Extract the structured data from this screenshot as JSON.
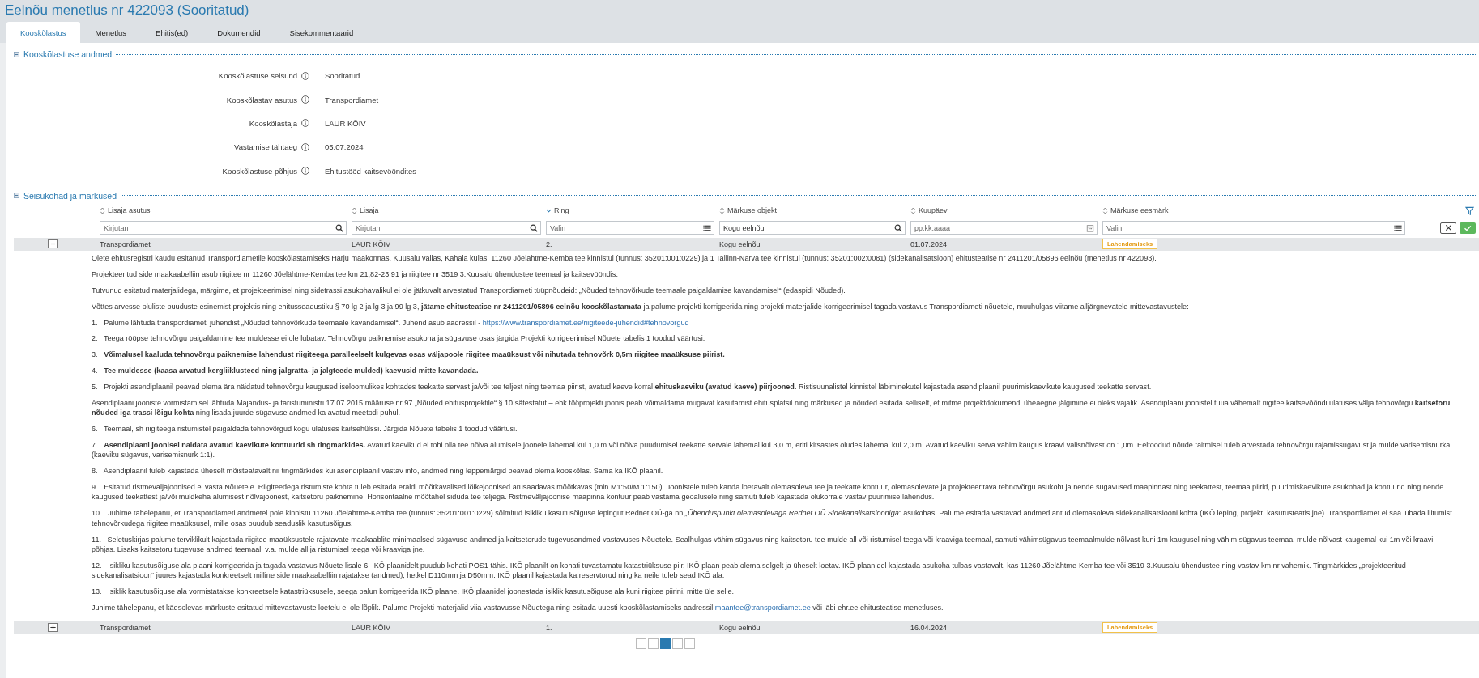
{
  "title": "Eelnõu menetlus nr 422093 (Sooritatud)",
  "tabs": [
    {
      "label": "Kooskõlastus",
      "selected": true
    },
    {
      "label": "Menetlus",
      "selected": false
    },
    {
      "label": "Ehitis(ed)",
      "selected": false
    },
    {
      "label": "Dokumendid",
      "selected": false
    },
    {
      "label": "Sisekommentaarid",
      "selected": false
    }
  ],
  "details": {
    "title": "Kooskõlastuse andmed",
    "expanded": true,
    "fields": [
      {
        "label": "Kooskõlastuse seisund",
        "value": "Sooritatud"
      },
      {
        "label": "Kooskõlastav asutus",
        "value": "Transpordiamet"
      },
      {
        "label": "Kooskõlastaja",
        "value": "LAUR KÕIV"
      },
      {
        "label": "Vastamise tähtaeg",
        "value": "05.07.2024"
      },
      {
        "label": "Kooskõlastuse põhjus",
        "value": "Ehitustööd kaitsevööndites"
      }
    ]
  },
  "remarks": {
    "title": "Seisukohad ja märkused",
    "expanded": true,
    "columns": [
      {
        "label": "Lisaja asutus",
        "sorted": false
      },
      {
        "label": "Lisaja",
        "sorted": false
      },
      {
        "label": "Ring",
        "sorted": true
      },
      {
        "label": "Märkuse objekt",
        "sorted": false
      },
      {
        "label": "Kuupäev",
        "sorted": false
      },
      {
        "label": "Märkuse eesmärk",
        "sorted": false
      }
    ],
    "filters": [
      {
        "kind": "search",
        "placeholder": "Kirjutan"
      },
      {
        "kind": "search",
        "placeholder": "Kirjutan"
      },
      {
        "kind": "list",
        "placeholder": "Valin"
      },
      {
        "kind": "search",
        "value": "Kogu eelnõu"
      },
      {
        "kind": "date",
        "placeholder": "pp.kk.aaaa"
      },
      {
        "kind": "list",
        "placeholder": "Valin"
      }
    ],
    "rows": [
      {
        "expanded": true,
        "agency": "Transpordiamet",
        "author": "LAUR KÕIV",
        "round": "2.",
        "object": "Kogu eelnõu",
        "date": "01.07.2024",
        "purpose": "Lahendamiseks",
        "paragraphs": [
          {
            "kind": "plain",
            "text": "Olete ehitusregistri kaudu esitanud Transpordiametile kooskõlastamiseks Harju maakonnas, Kuusalu vallas, Kahala külas, 11260 Jõelähtme-Kemba tee kinnistul (tunnus: 35201:001:0229) ja 1 Tallinn-Narva tee kinnistul (tunnus: 35201:002:0081) (sidekanalisatsioon) ehitusteatise nr 2411201/05896 eelnõu (menetlus nr 422093)."
          },
          {
            "kind": "plain",
            "text": "Projekteeritud side maakaabelliin asub riigitee nr 11260 Jõelähtme-Kemba tee km 21,82-23,91 ja riigitee nr 3519 3.Kuusalu ühendustee teemaal ja kaitsevööndis."
          },
          {
            "kind": "plain",
            "text": "Tutvunud esitatud materjalidega, märgime, et projekteerimisel ning sidetrassi asukohavalikul ei ole jätkuvalt arvestatud Transpordiameti tüüpnõudeid: „Nõuded tehnovõrkude teemaale paigaldamise kavandamisel“ (edaspidi Nõuded)."
          },
          {
            "kind": "plain",
            "text": "Võttes arvesse oluliste puuduste esinemist projektis ning ehitusseadustiku § 70 lg 2 ja lg 3 ja 99 lg 3, **jätame ehitusteatise nr 2411201/05896 eelnõu kooskõlastamata** ja palume projekti korrigeerida ning projekti materjalide korrigeerimisel tagada vastavus Transpordiameti nõuetele, muuhulgas viitame alljärgnevatele mittevastavustele:"
          },
          {
            "kind": "numbered",
            "number": "1.",
            "text": "Palume lähtuda transpordiameti juhendist „Nõuded tehnovõrkude teemaale kavandamisel“. Juhend asub aadressil -",
            "link": "https://www.transpordiamet.ee/riigiteede-juhendid#tehnovorgud"
          },
          {
            "kind": "numbered",
            "number": "2.",
            "text": "Teega rööpse tehnovõrgu paigaldamine tee muldesse ei ole lubatav. Tehnovõrgu paiknemise asukoha ja sügavuse osas järgida Projekti korrigeerimisel Nõuete tabelis 1 toodud väärtusi."
          },
          {
            "kind": "numbered",
            "number": "3.",
            "text": "**Võimalusel kaaluda tehnovõrgu paiknemise lahendust riigiteega paralleelselt kulgevas osas väljapoole riigitee maaüksust või nihutada tehnovõrk 0,5m riigitee maaüksuse piirist.**"
          },
          {
            "kind": "numbered",
            "number": "4.",
            "text": "**Tee muldesse (kaasa arvatud kergliiklusteed ning jalgratta- ja jalgteede mulded) kaevusid mitte kavandada.**"
          },
          {
            "kind": "numbered",
            "number": "5.",
            "text": "Projekti asendiplaanil peavad olema ära näidatud tehnovõrgu kaugused iseloomulikes kohtades teekatte servast ja/või tee teljest ning teemaa piirist, avatud kaeve korral **ehituskaeviku (avatud kaeve) piirjooned**. Ristisuunalistel kinnistel läbiminekutel kajastada asendiplaanil puurimiskaevikute kaugused teekatte servast."
          },
          {
            "kind": "plain",
            "text": "Asendiplaani jooniste vormistamisel lähtuda Majandus- ja taristuministri 17.07.2015 määruse nr 97 „Nõuded ehitusprojektile“ § 10 sätestatut – ehk tööprojekti joonis peab võimaldama mugavat kasutamist ehitusplatsil ning märkused ja nõuded esitada selliselt, et mitme projektdokumendi üheaegne jälgimine ei oleks vajalik.  Asendiplaani joonistel tuua vähemalt riigitee kaitsevööndi ulatuses välja tehnovõrgu **kaitsetoru nõuded iga trassi lõigu kohta** ning lisada juurde sügavuse andmed ka avatud meetodi puhul."
          },
          {
            "kind": "numbered",
            "number": "6.",
            "text": "Teemaal, sh riigiteega ristumistel paigaldada tehnovõrgud kogu ulatuses kaitsehülssi. Järgida Nõuete tabelis 1 toodud väärtusi."
          },
          {
            "kind": "numbered",
            "number": "7.",
            "text": "**Asendiplaani joonisel näidata avatud kaevikute kontuurid sh tingmärkides.** Avatud kaevikud ei tohi olla tee nõlva alumisele joonele lähemal kui 1,0 m või nõlva puudumisel teekatte servale lähemal kui 3,0 m, eriti kitsastes oludes lähemal kui 2,0 m. Avatud kaeviku serva vähim kaugus kraavi välisnõlvast on 1,0m. Eeltoodud nõude täitmisel tuleb arvestada tehnovõrgu rajamissügavust ja mulde varisemisnurka (kaeviku sügavus, varisemisnurk 1:1)."
          },
          {
            "kind": "numbered",
            "number": "8.",
            "text": "Asendiplaanil tuleb kajastada üheselt mõisteatavalt nii tingmärkides kui asendiplaanil vastav info, andmed ning leppemärgid peavad olema kooskõlas. Sama ka IKÕ plaanil."
          },
          {
            "kind": "numbered",
            "number": "9.",
            "text": "Esitatud ristmeväljajoonised ei vasta Nõuetele. Riigiteedega ristumiste kohta tuleb esitada eraldi mõõtkavalised lõikejoonised arusaadavas mõõtkavas (min M1:50/M 1:150). Joonistele tuleb kanda loetavalt olemasoleva tee ja teekatte kontuur, olemasolevate ja projekteeritava tehnovõrgu asukoht ja nende sügavused maapinnast ning teekattest, teemaa piirid, puurimiskaevikute asukohad ja kontuurid ning nende kaugused teekattest ja/või muldkeha alumisest nõlvajoonest, kaitsetoru paiknemine. Horisontaalne mõõtahel siduda tee teljega. Ristmeväljajoonise maapinna kontuur peab vastama geoalusele ning samuti tuleb kajastada olukorrale vastav puurimise lahendus."
          },
          {
            "kind": "numbered",
            "number": "10.",
            "text": "Juhime tähelepanu, et Transpordiameti andmetel pole kinnistu 11260 Jõelähtme-Kemba tee (tunnus: 35201:001:0229) sõlmitud isikliku kasutusõiguse lepingut Rednet OÜ-ga nn *„Ühenduspunkt olemasolevaga Rednet OÜ Sidekanalisatsiooniga“* asukohas. Palume esitada vastavad andmed antud olemasoleva sidekanalisatsiooni kohta (IKÕ leping, projekt, kasutusteatis jne). Transpordiamet ei saa lubada liitumist tehnovõrkudega riigitee maaüksusel, mille osas puudub seaduslik kasutusõigus."
          },
          {
            "kind": "numbered",
            "number": "11.",
            "text": "Seletuskirjas palume terviklikult kajastada riigitee maaüksustele rajatavate maakaablite minimaalsed sügavuse andmed ja kaitsetorude tugevusandmed vastavuses Nõuetele. Sealhulgas vähim sügavus ning kaitsetoru tee mulde all või ristumisel teega või kraaviga teemaal, samuti vähimsügavus teemaalmulde nõlvast kuni 1m kaugusel ning vähim sügavus teemaal mulde nõlvast kaugemal kui 1m või kraavi põhjas. Lisaks kaitsetoru tugevuse andmed teemaal, v.a. mulde all ja ristumisel teega või kraaviga jne."
          },
          {
            "kind": "numbered",
            "number": "12.",
            "text": "Isikliku kasutusõiguse ala plaani korrigeerida ja tagada vastavus Nõuete lisale 6. IKÕ plaanidelt puudub kohati POS1 tähis. IKÕ plaanilt on kohati tuvastamatu katastriüksuse piir. IKÕ plaan peab olema selgelt ja üheselt loetav. IKÕ plaanidel kajastada asukoha tulbas vastavalt, kas 11260 Jõelähtme-Kemba tee või 3519 3.Kuusalu ühendustee ning vastav km nr vahemik. Tingmärkides „projekteeritud sidekanalisatsioon“ juures kajastada konkreetselt milline side maakaabelliin rajatakse (andmed), hetkel D110mm ja D50mm. IKÕ plaanil kajastada ka reservtorud ning ka neile tuleb sead IKÕ ala."
          },
          {
            "kind": "numbered",
            "number": "13.",
            "text": "Isiklik kasutusõiguse ala vormistatakse konkreetsele katastriüksusele, seega palun korrigeerida IKÕ plaane. IKÕ plaanidel joonestada isiklik kasutusõiguse ala kuni riigitee piirini, mitte üle selle."
          },
          {
            "kind": "plain",
            "text": "Juhime tähelepanu, et käesolevas märkuste esitatud mittevastavuste loetelu ei ole lõplik. Palume Projekti materjalid viia vastavusse Nõuetega ning esitada uuesti kooskõlastamiseks aadressil",
            "link": "maantee@transpordiamet.ee",
            "text_after": "või läbi ehr.ee ehitusteatise menetluses."
          }
        ]
      },
      {
        "expanded": false,
        "agency": "Transpordiamet",
        "author": "LAUR KÕIV",
        "round": "1.",
        "object": "Kogu eelnõu",
        "date": "16.04.2024",
        "purpose": "Lahendamiseks"
      }
    ],
    "pagination": [
      {
        "selected": false
      },
      {
        "selected": false
      },
      {
        "selected": true
      },
      {
        "selected": false
      },
      {
        "selected": false
      }
    ]
  }
}
